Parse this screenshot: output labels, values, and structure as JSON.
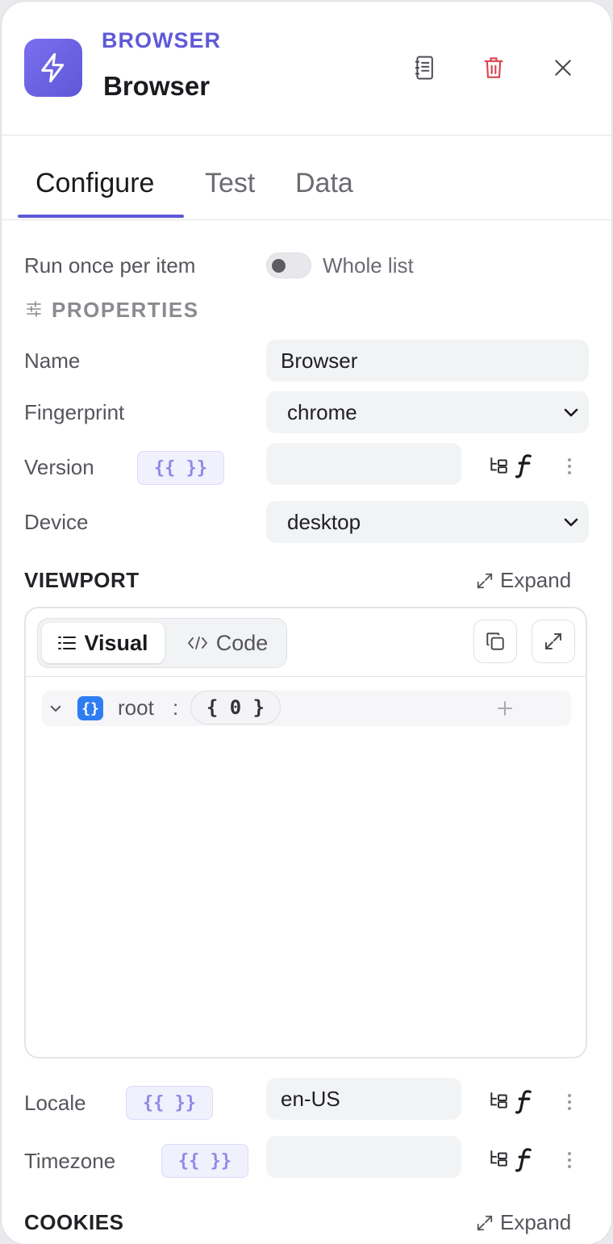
{
  "header": {
    "kicker": "BROWSER",
    "title": "Browser",
    "icons": {
      "app": "lightning-icon",
      "docs": "notebook-icon",
      "delete": "trash-icon",
      "close": "close-icon"
    }
  },
  "tabs": [
    {
      "label": "Configure",
      "active": true
    },
    {
      "label": "Test",
      "active": false
    },
    {
      "label": "Data",
      "active": false
    }
  ],
  "run_mode": {
    "label": "Run once per item",
    "toggle_label": "Whole list",
    "toggle_on": false
  },
  "properties": {
    "heading": "PROPERTIES",
    "name": {
      "label": "Name",
      "value": "Browser"
    },
    "fingerprint": {
      "label": "Fingerprint",
      "value": "chrome"
    },
    "version": {
      "label": "Version",
      "expr_badge": "{{ }}",
      "value": ""
    },
    "device": {
      "label": "Device",
      "value": "desktop"
    }
  },
  "viewport": {
    "heading": "VIEWPORT",
    "expand_label": "Expand",
    "mode_visual": "Visual",
    "mode_code": "Code",
    "root_key": "root",
    "root_colon": ":",
    "root_count": "{ 0 }"
  },
  "locale": {
    "label": "Locale",
    "expr_badge": "{{ }}",
    "value": "en-US"
  },
  "timezone": {
    "label": "Timezone",
    "expr_badge": "{{ }}",
    "value": ""
  },
  "cookies": {
    "heading": "COOKIES",
    "expand_label": "Expand"
  },
  "colors": {
    "accent": "#5e5ad8",
    "danger": "#d9434f",
    "badge_blue": "#2f7df2"
  }
}
